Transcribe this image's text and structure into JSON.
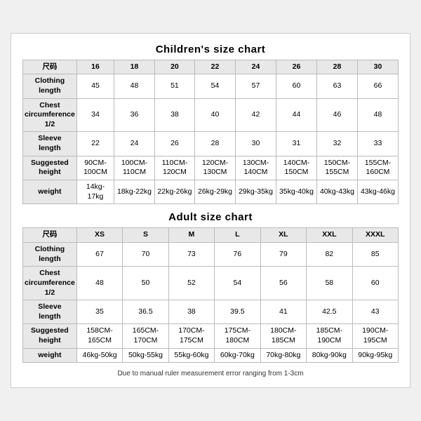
{
  "children_chart": {
    "title": "Children's size chart",
    "headers": [
      "尺码",
      "16",
      "18",
      "20",
      "22",
      "24",
      "26",
      "28",
      "30"
    ],
    "rows": [
      {
        "label": "Clothing\nlength",
        "values": [
          "45",
          "48",
          "51",
          "54",
          "57",
          "60",
          "63",
          "66"
        ]
      },
      {
        "label": "Chest\ncircumference\n1/2",
        "values": [
          "34",
          "36",
          "38",
          "40",
          "42",
          "44",
          "46",
          "48"
        ]
      },
      {
        "label": "Sleeve\nlength",
        "values": [
          "22",
          "24",
          "26",
          "28",
          "30",
          "31",
          "32",
          "33"
        ]
      },
      {
        "label": "Suggested\nheight",
        "values": [
          "90CM-100CM",
          "100CM-110CM",
          "110CM-120CM",
          "120CM-130CM",
          "130CM-140CM",
          "140CM-150CM",
          "150CM-155CM",
          "155CM-160CM"
        ]
      },
      {
        "label": "weight",
        "values": [
          "14kg-17kg",
          "18kg-22kg",
          "22kg-26kg",
          "26kg-29kg",
          "29kg-35kg",
          "35kg-40kg",
          "40kg-43kg",
          "43kg-46kg"
        ]
      }
    ]
  },
  "adult_chart": {
    "title": "Adult size chart",
    "headers": [
      "尺码",
      "XS",
      "S",
      "M",
      "L",
      "XL",
      "XXL",
      "XXXL"
    ],
    "rows": [
      {
        "label": "Clothing\nlength",
        "values": [
          "67",
          "70",
          "73",
          "76",
          "79",
          "82",
          "85"
        ]
      },
      {
        "label": "Chest\ncircumference\n1/2",
        "values": [
          "48",
          "50",
          "52",
          "54",
          "56",
          "58",
          "60"
        ]
      },
      {
        "label": "Sleeve\nlength",
        "values": [
          "35",
          "36.5",
          "38",
          "39.5",
          "41",
          "42.5",
          "43"
        ]
      },
      {
        "label": "Suggested\nheight",
        "values": [
          "158CM-165CM",
          "165CM-170CM",
          "170CM-175CM",
          "175CM-180CM",
          "180CM-185CM",
          "185CM-190CM",
          "190CM-195CM"
        ]
      },
      {
        "label": "weight",
        "values": [
          "46kg-50kg",
          "50kg-55kg",
          "55kg-60kg",
          "60kg-70kg",
          "70kg-80kg",
          "80kg-90kg",
          "90kg-95kg"
        ]
      }
    ]
  },
  "note": "Due to manual ruler measurement error ranging from 1-3cm"
}
